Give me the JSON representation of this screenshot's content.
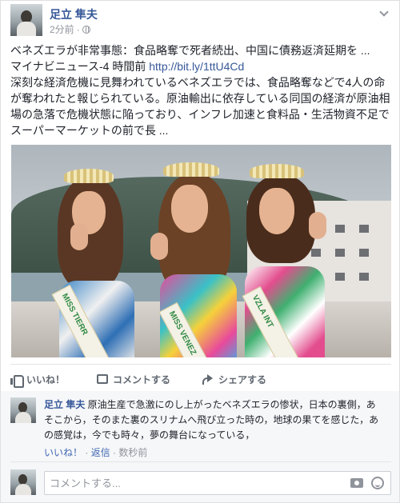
{
  "post": {
    "author": "足立 隼夫",
    "time": "2分前",
    "separator": "·",
    "text_lines": [
      "ベネズエラが非常事態：食品略奪で死者続出、中国に債務返済延期を ...",
      "マイナビニュース-4 時間前 ",
      "深刻な経済危機に見舞われているベネズエラでは、食品略奪などで4人の命",
      "が奪われたと報じられている。原油輸出に依存している同国の経済が原油相",
      "場の急落で危機状態に陥っており、インフレ加速と食料品・生活物資不足で",
      "スーパーマーケットの前で長 ..."
    ],
    "link": "http://bit.ly/1ttU4Cd",
    "icons": {
      "privacy": "globe-icon",
      "menu": "chevron-down-icon"
    }
  },
  "photo": {
    "sash_texts": [
      "MISS TIERR",
      "MISS VENEZ",
      "VZLA INT"
    ]
  },
  "actions": {
    "like": "いいね！",
    "comment": "コメントする",
    "share": "シェアする"
  },
  "comment": {
    "author": "足立 隼夫",
    "lines": [
      " 原油生産で急激にのし上がったベネズエラの惨状，日本の裏側，あ",
      "そこから，そのまた裏のスリナムへ飛び立った時の，地球の果てを感じた，あ",
      "の感覚は，今でも時々，夢の舞台になっている，"
    ],
    "like_link": "いいね！",
    "reply_link": "返信",
    "dot": " · ",
    "time": "数秒前"
  },
  "reply": {
    "placeholder": "コメントする...",
    "icons": [
      "camera-icon",
      "emoji-icon"
    ]
  },
  "colors": {
    "link": "#365899",
    "secondary": "#90949c",
    "accent": "#4267b2"
  }
}
